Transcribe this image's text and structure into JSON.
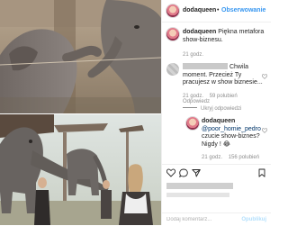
{
  "header": {
    "username": "dodaqueen",
    "dot": "•",
    "follow_label": "Obserwowanie"
  },
  "caption": {
    "username": "dodaqueen",
    "text": "Piękna metafora show-biznesu."
  },
  "comments": [
    {
      "time": "21 godz.",
      "text_line1": "Chwila",
      "text_rest": "moment. Przecież Ty pracujesz w show biznesie...",
      "likes": "59 polubień",
      "reply": "Odpowiedz",
      "hide_replies": "Ukryj odpowiedzi"
    },
    {
      "username": "dodaqueen",
      "mention": "@poor_homie_pedro",
      "text": " czucie show-biznes? Nigdy !",
      "emoji": "😂",
      "time": "21 godz.",
      "likes": "156 polubień"
    }
  ],
  "comment_box": {
    "placeholder": "Dodaj komentarz...",
    "publish_label": "Opublikuj"
  },
  "icons": {
    "like": "heart-icon",
    "comment": "speech-bubble-icon",
    "share": "paper-plane-icon",
    "save": "bookmark-icon"
  },
  "colors": {
    "link": "#3897f0",
    "text": "#262626",
    "meta": "#8e8e8e"
  }
}
